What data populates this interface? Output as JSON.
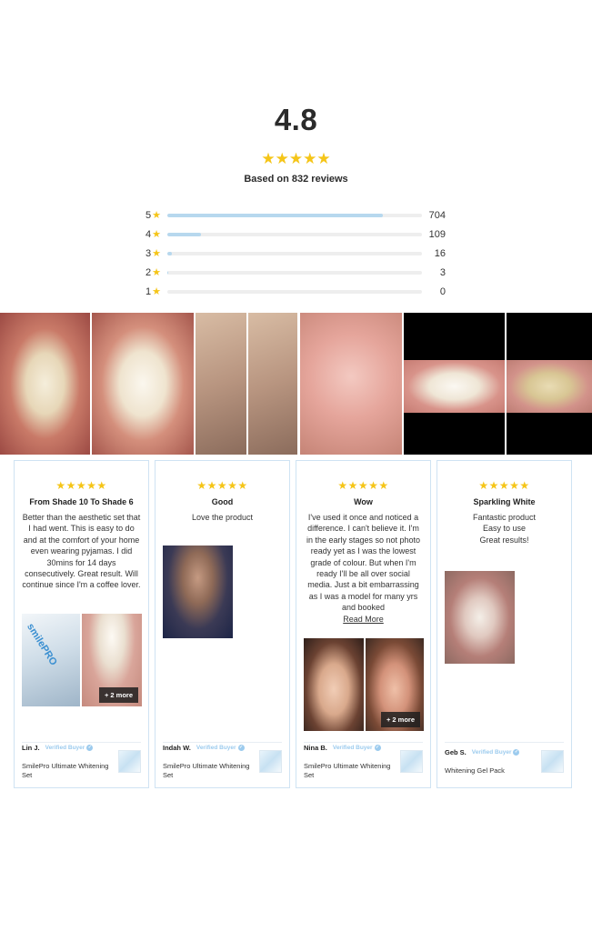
{
  "summary": {
    "average": "4.8",
    "stars": "★★★★★",
    "based_on": "Based on 832 reviews"
  },
  "distribution": [
    {
      "stars": "5",
      "count": "704",
      "fraction": 0.846
    },
    {
      "stars": "4",
      "count": "109",
      "fraction": 0.131
    },
    {
      "stars": "3",
      "count": "16",
      "fraction": 0.019
    },
    {
      "stars": "2",
      "count": "3",
      "fraction": 0.004
    },
    {
      "stars": "1",
      "count": "0",
      "fraction": 0.0
    }
  ],
  "cards": [
    {
      "stars": "★★★★★",
      "title": "From Shade 10 To Shade 6",
      "body": "Better than the aesthetic set that I had went. This is easy to do and at the comfort of your home even wearing pyjamas. I did 30mins for 14 days consecutively. Great result. Will continue since I'm a coffee lover.",
      "more_badge": "+ 2 more",
      "product_logo": "smilePRO",
      "reviewer": "Lin J.",
      "verified": "Verified Buyer",
      "product": "SmilePro Ultimate Whitening Set"
    },
    {
      "stars": "★★★★★",
      "title": "Good",
      "body": "Love the product",
      "reviewer": "Indah W.",
      "verified": "Verified Buyer",
      "product": "SmilePro Ultimate Whitening Set"
    },
    {
      "stars": "★★★★★",
      "title": "Wow",
      "body": "I've used it once and noticed a difference. I can't believe it. I'm in the early stages so not photo ready yet as I was the lowest grade of colour. But when I'm ready I'll be all over social media. Just a bit embarrassing as I was a model for many yrs and booked",
      "read_more": "Read More",
      "more_badge": "+ 2 more",
      "reviewer": "Nina B.",
      "verified": "Verified Buyer",
      "product": "SmilePro Ultimate Whitening Set"
    },
    {
      "stars": "★★★★★",
      "title": "Sparkling White",
      "body": "Fantastic product\nEasy to use\nGreat results!",
      "reviewer": "Geb S.",
      "verified": "Verified Buyer",
      "product": "Whitening Gel Pack"
    }
  ],
  "icons": {
    "star": "star-icon",
    "verified": "check-circle-icon"
  },
  "colors": {
    "star": "#f5c518",
    "bar_fill": "#b7d8ee",
    "bar_track": "#eeeeee",
    "verified": "#9ccbee",
    "card_border": "#cfe3f3"
  }
}
